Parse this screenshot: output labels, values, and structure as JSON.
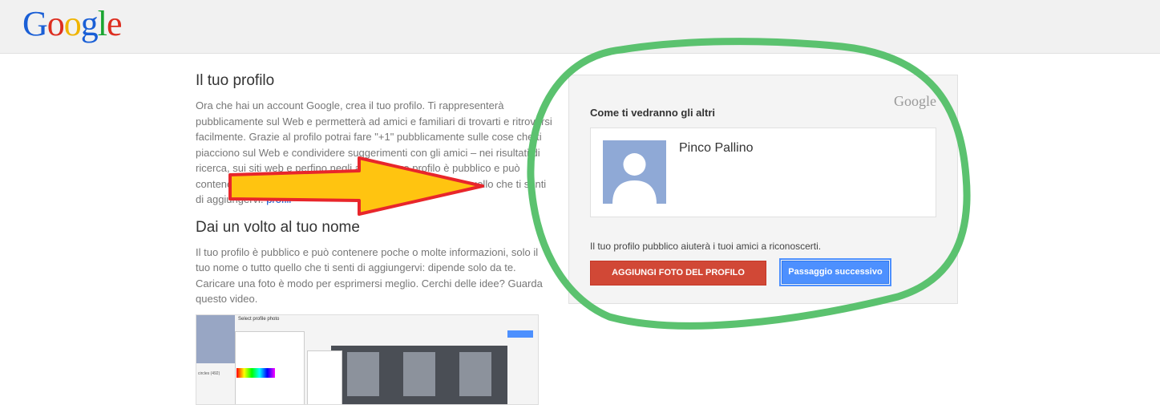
{
  "header": {
    "logo_letters": [
      {
        "ch": "G",
        "color": "#1a5fd6"
      },
      {
        "ch": "o",
        "color": "#dd2e20"
      },
      {
        "ch": "o",
        "color": "#f0b400"
      },
      {
        "ch": "g",
        "color": "#1a5fd6"
      },
      {
        "ch": "l",
        "color": "#1aa531"
      },
      {
        "ch": "e",
        "color": "#dd2e20"
      }
    ]
  },
  "profile_section": {
    "heading": "Il tuo profilo",
    "body": "Ora che hai un account Google, crea il tuo profilo. Ti rappresenterà pubblicamente sul Web e permetterà ad amici e familiari di trovarti e ritrovarsi facilmente. Grazie al profilo potrai fare \"+1\" pubblicamente sulle cose che ti piacciono sul Web e condividere suggerimenti con gli amici – nei risultati di ricerca, sui siti web e perfino negli ",
    "body_tail": "avvisi. Il tuo profilo è pubblico e può contenere poche o molte informazioni, solo il nome o tutto quello che ti senti di aggiungervi.",
    "link": "profili"
  },
  "face_section": {
    "heading": "Dai un volto al tuo nome",
    "body": "Il tuo profilo è pubblico e può contenere poche o molte informazioni, solo il tuo nome o tutto quello che ti senti di aggiungervi: dipende solo da te. Caricare una foto è modo per esprimersi meglio. Cerchi delle idee? Guarda questo video."
  },
  "video": {
    "title": "Select profile photo",
    "label": "circles (492)"
  },
  "card": {
    "logo": "Google",
    "title": "Come ti vedranno gli altri",
    "name": "Pinco Pallino",
    "helper": "Il tuo profilo pubblico aiuterà i tuoi amici a riconoscerti.",
    "add_photo_label": "AGGIUNGI FOTO DEL PROFILO",
    "next_label": "Passaggio successivo"
  },
  "annotations": {
    "arrow_fill": "#ffc410",
    "arrow_stroke": "#e8262b",
    "circle_stroke": "#5bc26f"
  }
}
